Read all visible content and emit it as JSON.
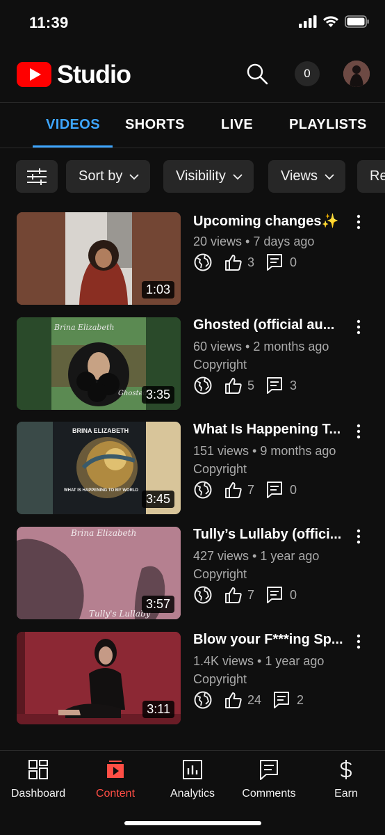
{
  "status": {
    "time": "11:39"
  },
  "header": {
    "app_name": "Studio",
    "notification_count": "0"
  },
  "tabs": [
    {
      "label": "VIDEOS",
      "active": true
    },
    {
      "label": "SHORTS",
      "active": false
    },
    {
      "label": "LIVE",
      "active": false
    },
    {
      "label": "PLAYLISTS",
      "active": false
    }
  ],
  "filters": {
    "sort_by": "Sort by",
    "visibility": "Visibility",
    "views": "Views",
    "partial": "Re"
  },
  "videos": [
    {
      "title": "Upcoming changes✨",
      "meta": "20 views • 7 days ago",
      "restriction": "",
      "likes": "3",
      "comments": "0",
      "duration": "1:03"
    },
    {
      "title": "Ghosted (official au...",
      "meta": "60 views • 2 months ago",
      "restriction": "Copyright",
      "likes": "5",
      "comments": "3",
      "duration": "3:35",
      "thumb_text_top": "Brina Elizabeth",
      "thumb_text_bottom": "Ghosted"
    },
    {
      "title": "What Is Happening T...",
      "meta": "151 views • 9 months ago",
      "restriction": "Copyright",
      "likes": "7",
      "comments": "0",
      "duration": "3:45",
      "thumb_text_top": "BRINA ELIZABETH",
      "thumb_text_bottom": "WHAT IS HAPPENING TO MY WORLD"
    },
    {
      "title": "Tully’s Lullaby (offici...",
      "meta": "427 views • 1 year ago",
      "restriction": "Copyright",
      "likes": "7",
      "comments": "0",
      "duration": "3:57",
      "thumb_text_top": "Brina Elizabeth",
      "thumb_text_bottom": "Tully's Lullaby"
    },
    {
      "title": "Blow your F***ing Sp...",
      "meta": "1.4K views • 1 year ago",
      "restriction": "Copyright",
      "likes": "24",
      "comments": "2",
      "duration": "3:11"
    }
  ],
  "bottom_nav": [
    {
      "label": "Dashboard",
      "icon": "dashboard-icon",
      "active": false
    },
    {
      "label": "Content",
      "icon": "content-icon",
      "active": true
    },
    {
      "label": "Analytics",
      "icon": "analytics-icon",
      "active": false
    },
    {
      "label": "Comments",
      "icon": "comments-icon",
      "active": false
    },
    {
      "label": "Earn",
      "icon": "dollar-icon",
      "active": false
    }
  ],
  "colors": {
    "accent_blue": "#3ea6ff",
    "brand_red": "#ff0000",
    "active_nav": "#ff4e45",
    "background": "#0f0f0f"
  }
}
